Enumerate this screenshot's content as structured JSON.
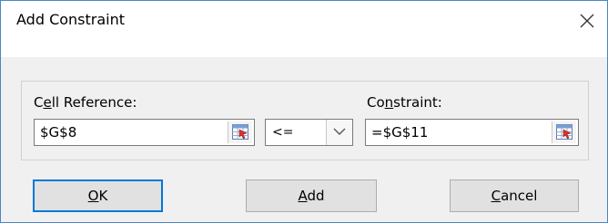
{
  "dialog": {
    "title": "Add Constraint",
    "close_icon": "close-icon"
  },
  "cell_reference": {
    "label_mnemonic": "e",
    "label_pre": "C",
    "label_post": "ll Reference:",
    "value": "$G$8",
    "button_icon": "range-select-icon"
  },
  "operator": {
    "value": "<=",
    "dropdown_icon": "chevron-down-icon"
  },
  "constraint": {
    "label_pre": "Co",
    "label_mnemonic": "n",
    "label_post": "straint:",
    "value": "=$G$11",
    "button_icon": "range-select-icon"
  },
  "buttons": {
    "ok_mnemonic": "O",
    "ok_rest": "K",
    "add_mnemonic": "A",
    "add_rest": "dd",
    "cancel_mnemonic": "C",
    "cancel_rest": "ancel"
  },
  "colors": {
    "accent": "#0078d7",
    "border": "#4a86c8",
    "panel": "#f0f0f0"
  }
}
